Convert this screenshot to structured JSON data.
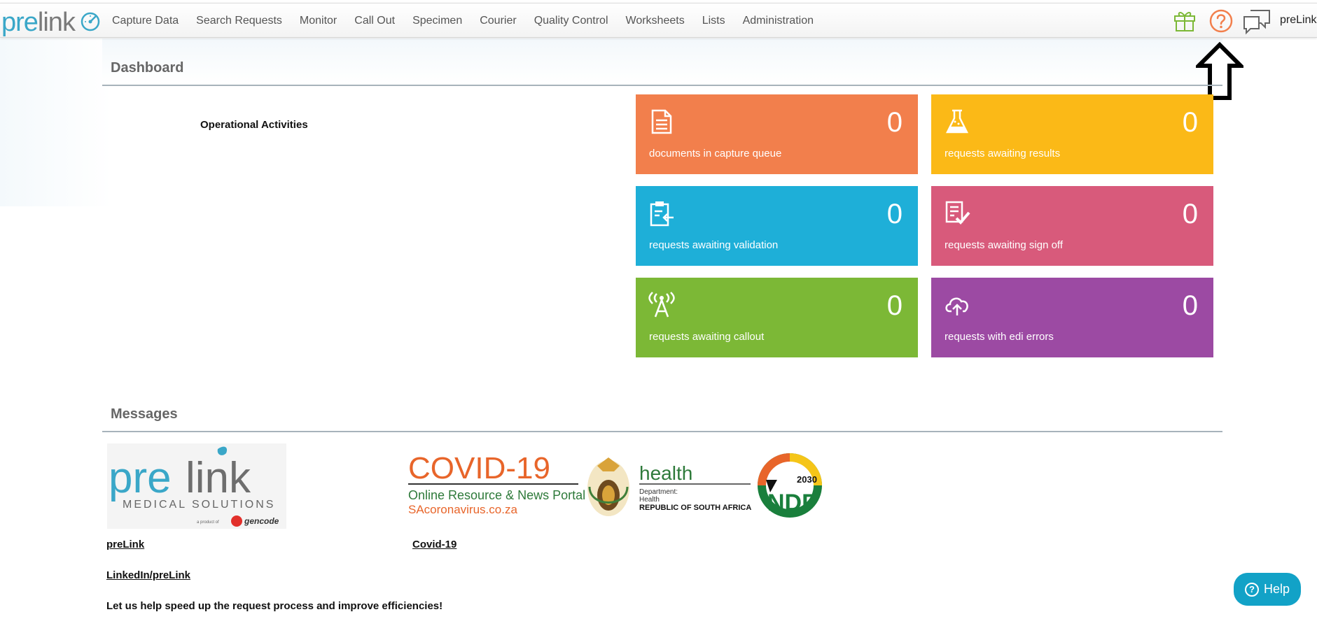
{
  "brand": {
    "pre": "pre",
    "link": "link"
  },
  "nav": {
    "items": [
      "Capture Data",
      "Search Requests",
      "Monitor",
      "Call Out",
      "Specimen",
      "Courier",
      "Quality Control",
      "Worksheets",
      "Lists",
      "Administration"
    ]
  },
  "header": {
    "user": "preLink",
    "icons": [
      "gift-icon",
      "help-circle-icon",
      "chat-icon",
      "dashboard-gauge-icon"
    ]
  },
  "dashboard": {
    "title": "Dashboard",
    "subtitle": "Operational Activities",
    "tiles": [
      {
        "icon": "document-icon",
        "count": "0",
        "label": "documents in capture queue",
        "color": "#f27f4c"
      },
      {
        "icon": "flask-icon",
        "count": "0",
        "label": "requests awaiting results",
        "color": "#fbb917"
      },
      {
        "icon": "clipboard-validate-icon",
        "count": "0",
        "label": "requests awaiting validation",
        "color": "#1eafd8"
      },
      {
        "icon": "sign-off-icon",
        "count": "0",
        "label": "requests awaiting sign off",
        "color": "#d85a7b"
      },
      {
        "icon": "antenna-icon",
        "count": "0",
        "label": "requests awaiting callout",
        "color": "#7cb836"
      },
      {
        "icon": "cloud-upload-icon",
        "count": "0",
        "label": "requests with edi errors",
        "color": "#9c4aa3"
      }
    ]
  },
  "messages": {
    "title": "Messages",
    "prelink_logo": {
      "pre": "pre",
      "link": "link",
      "tagline": "MEDICAL SOLUTIONS",
      "byline": "a product of",
      "company": "gencode"
    },
    "covid_banner": {
      "headline": "COVID-19",
      "portal": "Online Resource & News Portal",
      "site": "SAcoronavirus.co.za",
      "health": "health",
      "dept1": "Department:",
      "dept2": "Health",
      "country": "REPUBLIC OF SOUTH AFRICA",
      "ndp_year": "2030",
      "ndp": "NDP"
    },
    "link_prelink": "preLink",
    "link_covid": "Covid-19",
    "link_linkedin": "LinkedIn/preLink",
    "tagline": "Let us help speed up the request process and improve efficiencies!"
  },
  "help_button": {
    "label": "Help",
    "icon": "question-icon"
  },
  "colors": {
    "accent": "#3aa7c8",
    "help": "#12a2c7",
    "help_icon": "#f27f4c",
    "gift": "#7cb836"
  }
}
